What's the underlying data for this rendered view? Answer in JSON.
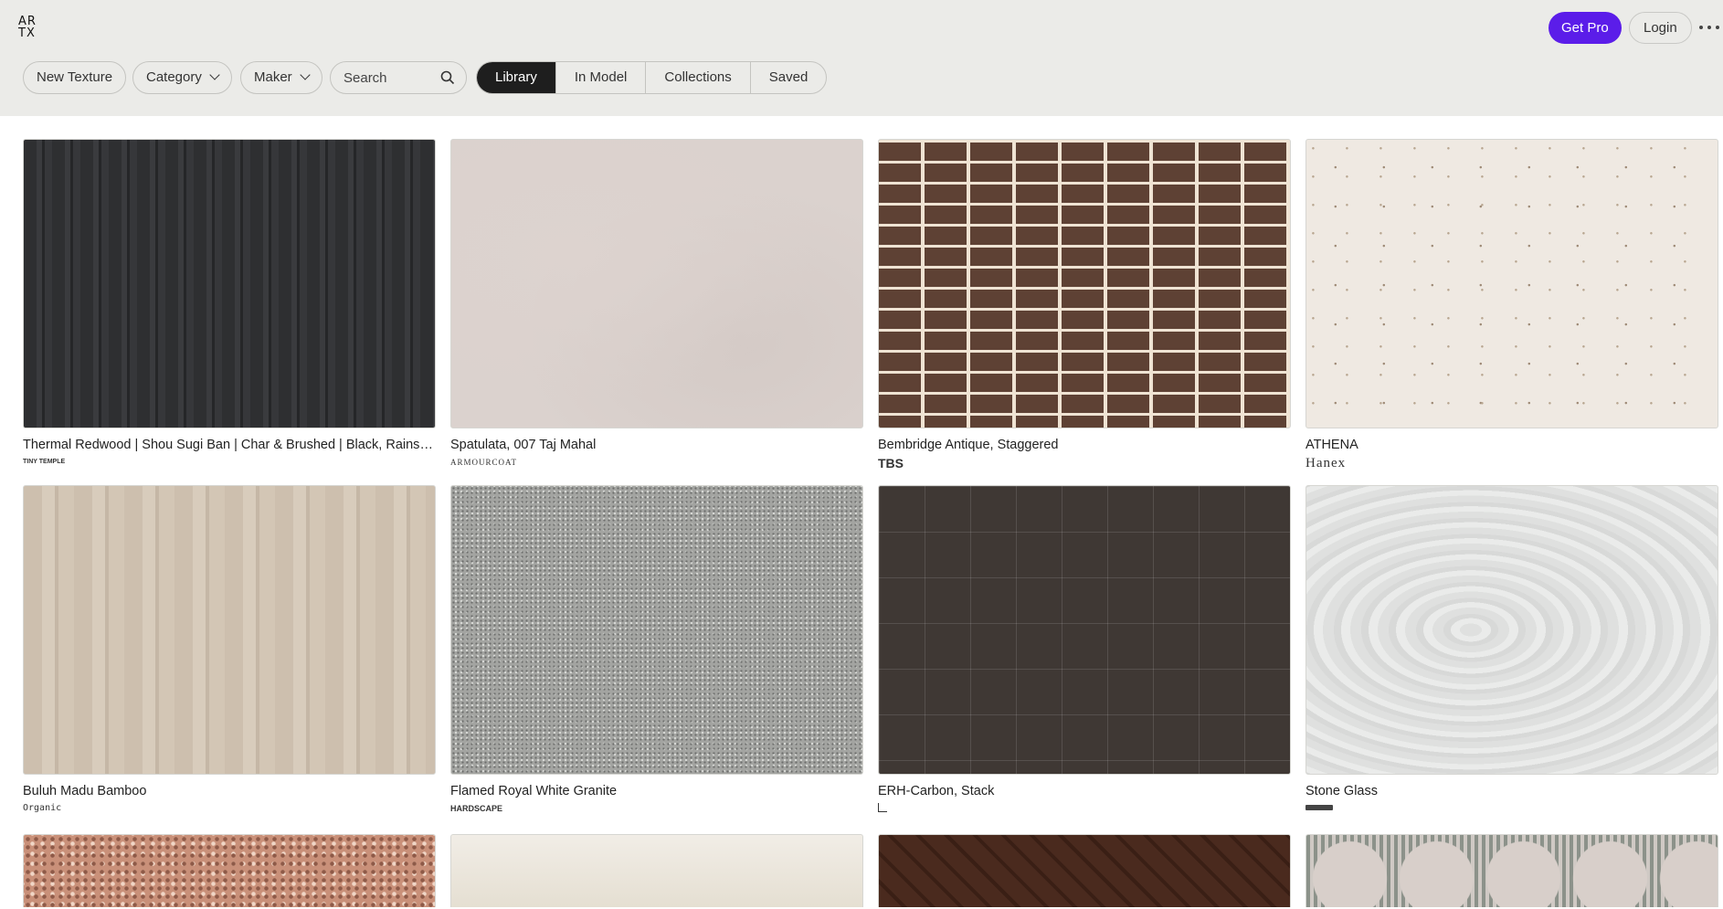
{
  "header": {
    "logo_top": "AR",
    "logo_bottom": "TX",
    "get_pro_label": "Get Pro",
    "login_label": "Login"
  },
  "toolbar": {
    "new_texture_label": "New Texture",
    "category_label": "Category",
    "maker_label": "Maker",
    "search_placeholder": "Search",
    "tabs": [
      "Library",
      "In Model",
      "Collections",
      "Saved"
    ],
    "active_tab": "Library"
  },
  "cards": [
    {
      "title": "Thermal Redwood | Shou Sugi Ban | Char & Brushed | Black, Rainscreen",
      "maker": "TINY TEMPLE",
      "texture": "wood"
    },
    {
      "title": "Spatulata, 007 Taj Mahal",
      "maker": "ARMOURCOAT",
      "texture": "marble"
    },
    {
      "title": "Bembridge Antique, Staggered",
      "maker": "TBS",
      "texture": "brick"
    },
    {
      "title": "ATHENA",
      "maker": "Hanex",
      "texture": "speckle"
    },
    {
      "title": "Buluh Madu Bamboo",
      "maker": "Organic",
      "texture": "bamboo"
    },
    {
      "title": "Flamed Royal White Granite",
      "maker": "HARDSCAPE",
      "texture": "granite"
    },
    {
      "title": "ERH-Carbon, Stack",
      "maker": "",
      "texture": "tile"
    },
    {
      "title": "Stone Glass",
      "maker": "",
      "texture": "glass"
    },
    {
      "title": "",
      "maker": "",
      "texture": "terrazzo"
    },
    {
      "title": "",
      "maker": "",
      "texture": "mural"
    },
    {
      "title": "",
      "maker": "",
      "texture": "herring"
    },
    {
      "title": "",
      "maker": "",
      "texture": "pattern"
    }
  ],
  "colors": {
    "accent": "#5b1de9",
    "header_bg": "#ebebe8",
    "active_tab_bg": "#1e1e1e"
  }
}
